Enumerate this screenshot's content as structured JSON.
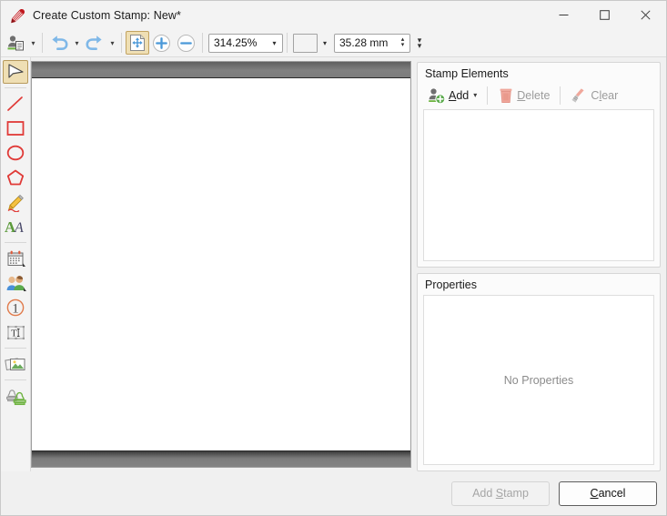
{
  "window": {
    "title": "Create Custom Stamp: New*",
    "app_icon": "pdf-stamp-icon",
    "caption": {
      "minimize": "minimize-icon",
      "maximize": "maximize-icon",
      "close": "close-icon"
    }
  },
  "toolbar": {
    "stamp_tool": {
      "name": "stamp-properties-icon",
      "label": ""
    },
    "undo": {
      "name": "undo-icon",
      "label": ""
    },
    "redo": {
      "name": "redo-icon",
      "label": ""
    },
    "pan_tool": {
      "name": "pan-page-icon",
      "label": "",
      "active": true
    },
    "zoom_in": {
      "name": "zoom-in-icon",
      "label": ""
    },
    "zoom_out": {
      "name": "zoom-out-icon",
      "label": ""
    },
    "zoom_level": {
      "value": "314.25%",
      "placeholder": "314.25%"
    },
    "color_swatch": {
      "value": "#ffffff",
      "name": "color-swatch"
    },
    "size_value": {
      "value": "35.28 mm",
      "placeholder": "35.28 mm"
    },
    "overflow": "toolbar-overflow-icon"
  },
  "tools": [
    {
      "id": "select",
      "label": "Select",
      "icon": "cursor-arrow-icon",
      "active": true
    },
    {
      "id": "line",
      "label": "Line",
      "icon": "line-icon",
      "active": false
    },
    {
      "id": "rectangle",
      "label": "Rectangle",
      "icon": "rectangle-icon",
      "active": false
    },
    {
      "id": "ellipse",
      "label": "Ellipse",
      "icon": "ellipse-icon",
      "active": false
    },
    {
      "id": "polygon",
      "label": "Polygon",
      "icon": "polygon-icon",
      "active": false
    },
    {
      "id": "pencil",
      "label": "Pencil",
      "icon": "pencil-icon",
      "active": false
    },
    {
      "id": "text",
      "label": "Text",
      "icon": "text-aa-icon",
      "active": false
    },
    {
      "id": "date",
      "label": "Date",
      "icon": "calendar-icon",
      "active": false
    },
    {
      "id": "identity",
      "label": "Identity",
      "icon": "contacts-icon",
      "active": false
    },
    {
      "id": "numbering",
      "label": "Numbering",
      "icon": "number-one-icon",
      "active": false
    },
    {
      "id": "text-field",
      "label": "Text Field",
      "icon": "text-field-icon",
      "active": false
    },
    {
      "id": "image",
      "label": "Image",
      "icon": "image-icon",
      "active": false
    },
    {
      "id": "stamp",
      "label": "Stamp",
      "icon": "rubber-stamp-icon",
      "active": false
    }
  ],
  "stamp_elements": {
    "title": "Stamp Elements",
    "add": {
      "label_pre": "",
      "label_key": "A",
      "label_post": "dd",
      "icon": "add-element-icon",
      "enabled": true
    },
    "delete": {
      "label_pre": "",
      "label_key": "D",
      "label_post": "elete",
      "icon": "trash-icon",
      "enabled": false
    },
    "clear": {
      "label_pre": "C",
      "label_key": "l",
      "label_post": "ear",
      "icon": "broom-icon",
      "enabled": false
    },
    "items": []
  },
  "properties": {
    "title": "Properties",
    "empty_text": "No Properties"
  },
  "footer": {
    "add_stamp": {
      "label_pre": "Add ",
      "label_key": "S",
      "label_post": "tamp",
      "enabled": false
    },
    "cancel": {
      "label_pre": "",
      "label_key": "C",
      "label_post": "ancel",
      "enabled": true
    }
  },
  "colors": {
    "accent_red": "#c0161c",
    "tool_red": "#e03a37",
    "tool_green": "#6db33f",
    "arrow_blue": "#7fb8e8",
    "active_tan": "#efdfb4"
  }
}
